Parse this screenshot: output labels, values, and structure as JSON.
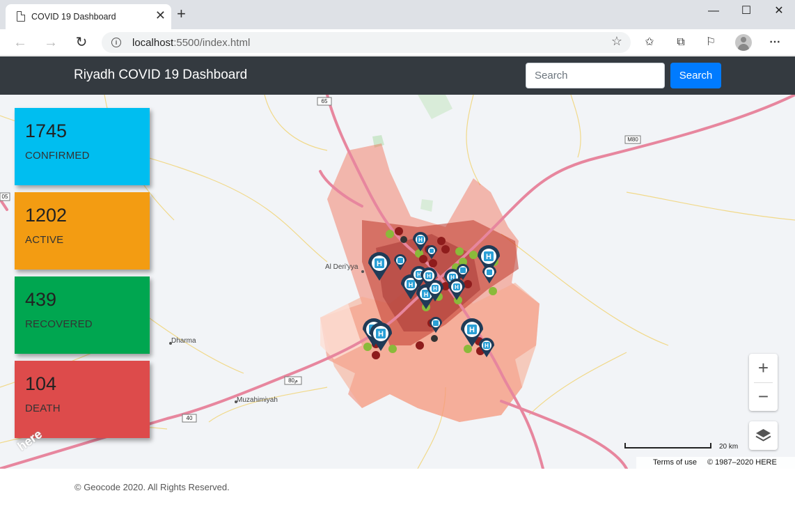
{
  "browser": {
    "tab_title": "COVID 19 Dashboard",
    "url_host": "localhost",
    "url_rest": ":5500/index.html"
  },
  "navbar": {
    "brand": "Riyadh COVID 19 Dashboard",
    "search_placeholder": "Search",
    "search_button": "Search"
  },
  "stats": [
    {
      "value": "1745",
      "label": "CONFIRMED",
      "color": "#00bef0"
    },
    {
      "value": "1202",
      "label": "ACTIVE",
      "color": "#f39c12"
    },
    {
      "value": "439",
      "label": "RECOVERED",
      "color": "#00a650"
    },
    {
      "value": "104",
      "label": "DEATH",
      "color": "#dd4b4b"
    }
  ],
  "map": {
    "places": [
      "Al Deri'yya",
      "Dharma",
      "Muzahimiyah"
    ],
    "road_labels": [
      "65",
      "M80",
      "40",
      "80م",
      "05"
    ],
    "scale_label": "20 km",
    "terms": "Terms of use",
    "copyright": "© 1987–2020 HERE",
    "logo": "here"
  },
  "footer": {
    "text": "© Geocode 2020. All Rights Reserved."
  }
}
